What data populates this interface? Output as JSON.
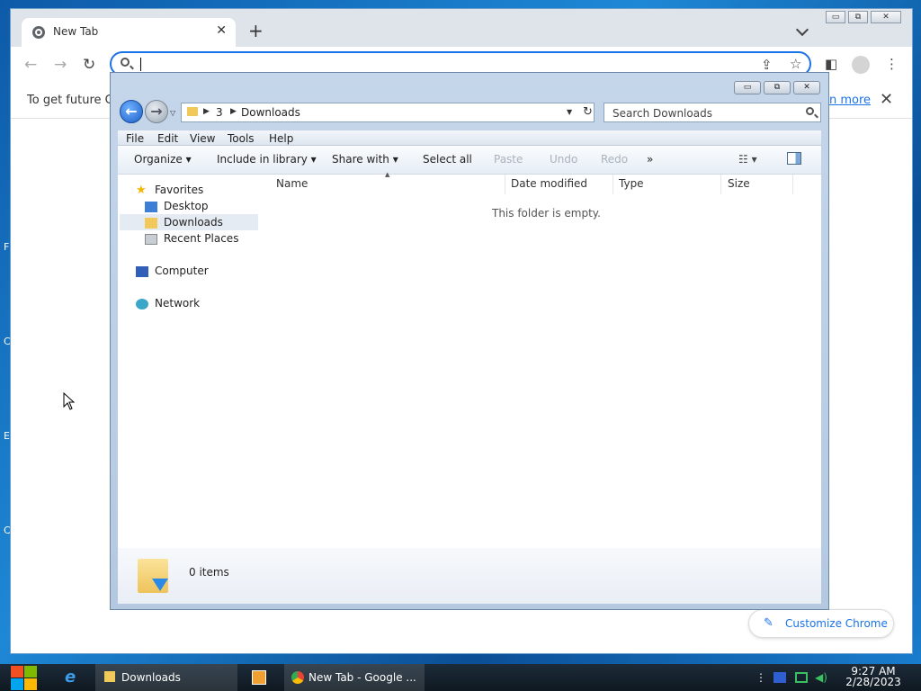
{
  "desktop": {
    "edge_letters": [
      "F",
      "C",
      "E",
      "C"
    ]
  },
  "chrome": {
    "tab_title": "New Tab",
    "tab_close": "✕",
    "new_tab": "+",
    "omnibox": {
      "value": "",
      "placeholder": ""
    },
    "infobar_text": "To get future Go",
    "infobar_link": "n more",
    "infobar_close": "✕",
    "customize_label": "Customize Chrome",
    "window_controls": [
      "▭",
      "⧉",
      "✕"
    ]
  },
  "explorer": {
    "window_controls": [
      "▭",
      "⧉",
      "✕"
    ],
    "address": {
      "segments": [
        "3",
        "Downloads"
      ]
    },
    "search_placeholder": "Search Downloads",
    "menu": [
      "File",
      "Edit",
      "View",
      "Tools",
      "Help"
    ],
    "commands": {
      "organize": "Organize ▾",
      "include": "Include in library ▾",
      "share": "Share with ▾",
      "select_all": "Select all",
      "paste": "Paste",
      "undo": "Undo",
      "redo": "Redo",
      "more": "»"
    },
    "nav": {
      "favorites": "Favorites",
      "desktop": "Desktop",
      "downloads": "Downloads",
      "recent": "Recent Places",
      "computer": "Computer",
      "network": "Network"
    },
    "columns": [
      "Name",
      "Date modified",
      "Type",
      "Size"
    ],
    "empty_text": "This folder is empty.",
    "item_count": "0 items"
  },
  "taskbar": {
    "downloads_label": "Downloads",
    "chrome_label": "New Tab - Google ...",
    "time": "9:27 AM",
    "date": "2/28/2023"
  }
}
